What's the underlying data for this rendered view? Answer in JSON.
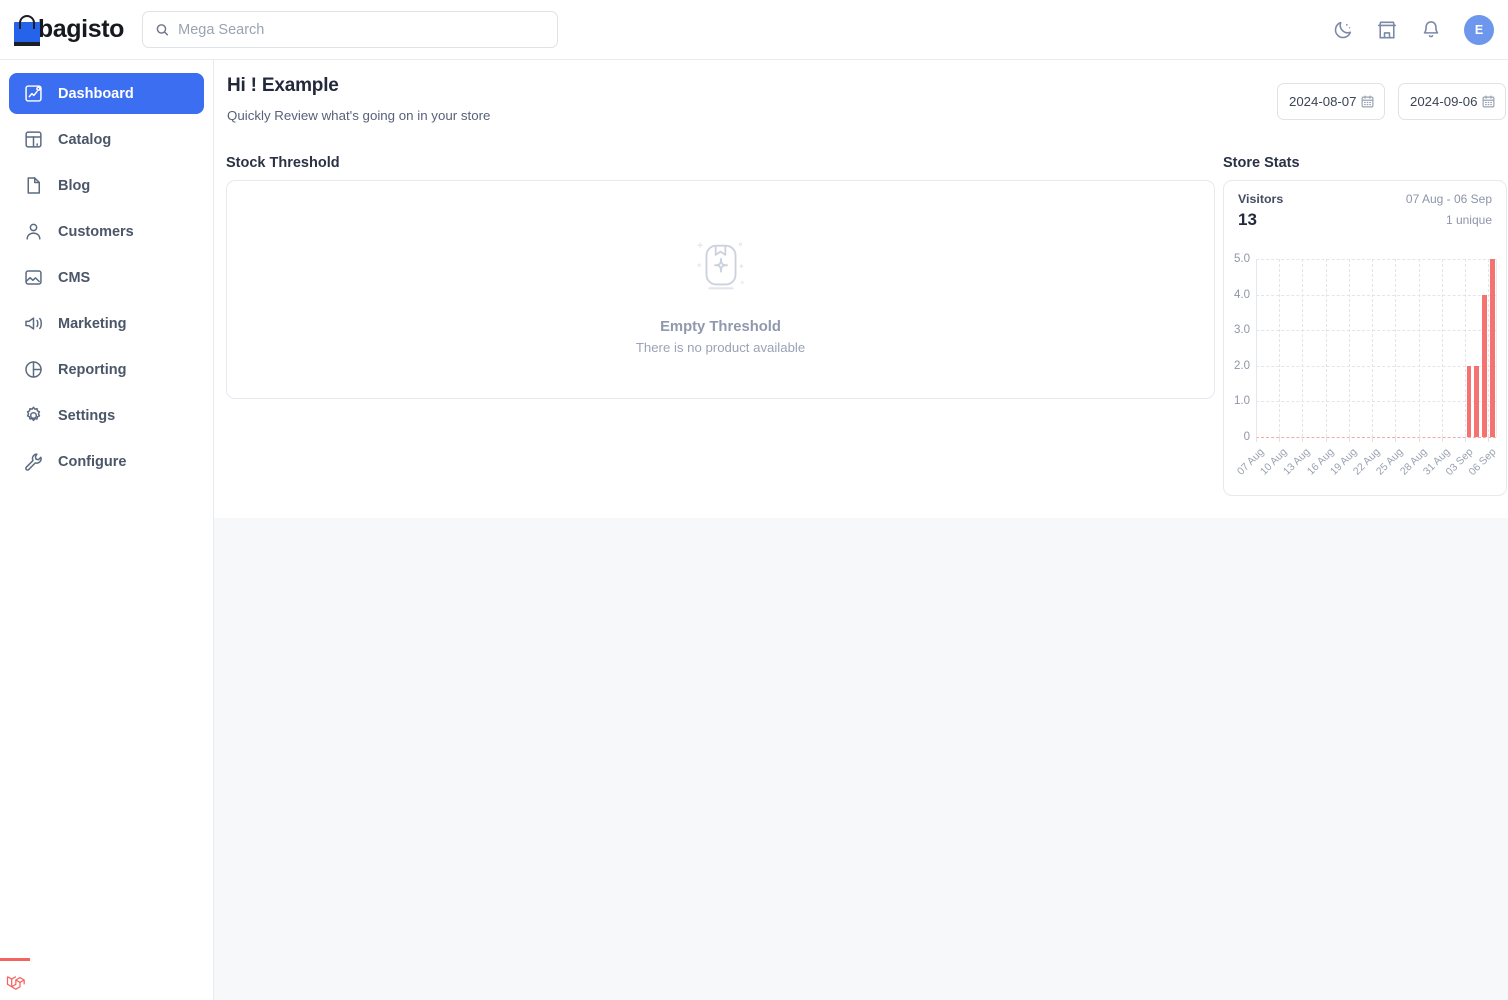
{
  "topbar": {
    "brand": "bagisto",
    "search_placeholder": "Mega Search",
    "search_value": "",
    "icons": {
      "search": "search-icon",
      "dark_mode": "moon-icon",
      "store": "store-icon",
      "notifications": "bell-icon"
    },
    "avatar_initial": "E"
  },
  "sidebar": {
    "items": [
      {
        "label": "Dashboard",
        "icon": "dashboard-icon",
        "active": true
      },
      {
        "label": "Catalog",
        "icon": "catalog-icon",
        "active": false
      },
      {
        "label": "Blog",
        "icon": "blog-icon",
        "active": false
      },
      {
        "label": "Customers",
        "icon": "customers-icon",
        "active": false
      },
      {
        "label": "CMS",
        "icon": "cms-icon",
        "active": false
      },
      {
        "label": "Marketing",
        "icon": "marketing-icon",
        "active": false
      },
      {
        "label": "Reporting",
        "icon": "reporting-icon",
        "active": false
      },
      {
        "label": "Settings",
        "icon": "settings-gear-icon",
        "active": false
      },
      {
        "label": "Configure",
        "icon": "wrench-icon",
        "active": false
      }
    ]
  },
  "page": {
    "title": "Hi ! Example",
    "subtitle": "Quickly Review what's going on in your store",
    "date_from": "2024-08-07",
    "date_to": "2024-09-06",
    "calendar_icon": "calendar-icon"
  },
  "stock_threshold": {
    "section_title": "Stock Threshold",
    "empty_icon": "empty-box-icon",
    "empty_title": "Empty Threshold",
    "empty_desc": "There is no product available"
  },
  "store_stats": {
    "section_title": "Store Stats",
    "visitors_label": "Visitors",
    "visitors_count": "13",
    "range": "07 Aug - 06 Sep",
    "unique": "1 unique"
  },
  "colors": {
    "accent": "#3b6ef0",
    "bar": "#f4726f",
    "avatar": "#6d97ec",
    "brand_bag": "#2563eb",
    "page_bg": "#f6f8fa"
  },
  "chart_data": {
    "type": "bar",
    "title": "Visitors",
    "xlabel": "",
    "ylabel": "",
    "ylim": [
      0,
      5
    ],
    "yticks": [
      "0",
      "1.0",
      "2.0",
      "3.0",
      "4.0",
      "5.0"
    ],
    "ytick_values": [
      0,
      1,
      2,
      3,
      4,
      5
    ],
    "grid": true,
    "legend": false,
    "tick_labels": [
      "07 Aug",
      "10 Aug",
      "13 Aug",
      "16 Aug",
      "19 Aug",
      "22 Aug",
      "25 Aug",
      "28 Aug",
      "31 Aug",
      "03 Sep",
      "06 Sep"
    ],
    "categories": [
      "07 Aug",
      "08 Aug",
      "09 Aug",
      "10 Aug",
      "11 Aug",
      "12 Aug",
      "13 Aug",
      "14 Aug",
      "15 Aug",
      "16 Aug",
      "17 Aug",
      "18 Aug",
      "19 Aug",
      "20 Aug",
      "21 Aug",
      "22 Aug",
      "23 Aug",
      "24 Aug",
      "25 Aug",
      "26 Aug",
      "27 Aug",
      "28 Aug",
      "29 Aug",
      "30 Aug",
      "31 Aug",
      "01 Sep",
      "02 Sep",
      "03 Sep",
      "04 Sep",
      "05 Sep",
      "06 Sep"
    ],
    "values": [
      0,
      0,
      0,
      0,
      0,
      0,
      0,
      0,
      0,
      0,
      0,
      0,
      0,
      0,
      0,
      0,
      0,
      0,
      0,
      0,
      0,
      0,
      0,
      0,
      0,
      0,
      0,
      2,
      2,
      4,
      5
    ],
    "total": 13
  }
}
